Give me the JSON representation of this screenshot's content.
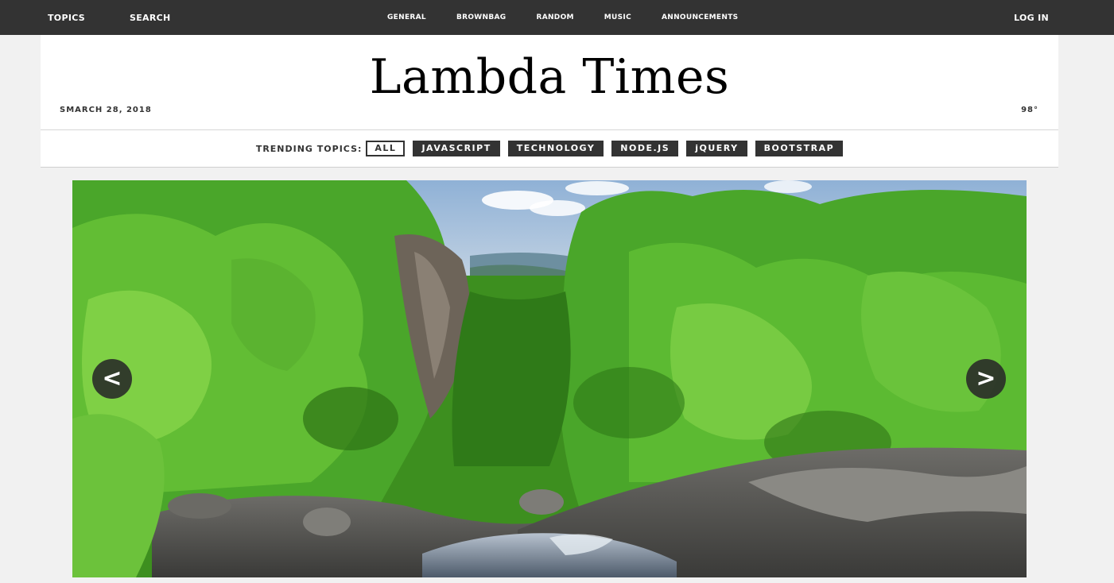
{
  "nav": {
    "left": [
      "TOPICS",
      "SEARCH"
    ],
    "center": [
      "GENERAL",
      "BROWNBAG",
      "RANDOM",
      "MUSIC",
      "ANNOUNCEMENTS"
    ],
    "right": "LOG IN"
  },
  "header": {
    "title": "Lambda Times",
    "date": "SMARCH 28, 2018",
    "temperature": "98°"
  },
  "trending": {
    "label": "TRENDING TOPICS:",
    "tabs": [
      "ALL",
      "JAVASCRIPT",
      "TECHNOLOGY",
      "NODE.JS",
      "jQUERY",
      "BOOTSTRAP"
    ],
    "active": "ALL"
  },
  "carousel": {
    "prev_label": "<",
    "next_label": ">"
  },
  "colors": {
    "nav_bg": "#333333",
    "page_bg": "#f1f1f1",
    "tab_bg": "#333333",
    "foliage": "#3f9a1f",
    "sky": "#a9c4de"
  },
  "icons": {
    "prev": "chevron-left-icon",
    "next": "chevron-right-icon"
  }
}
